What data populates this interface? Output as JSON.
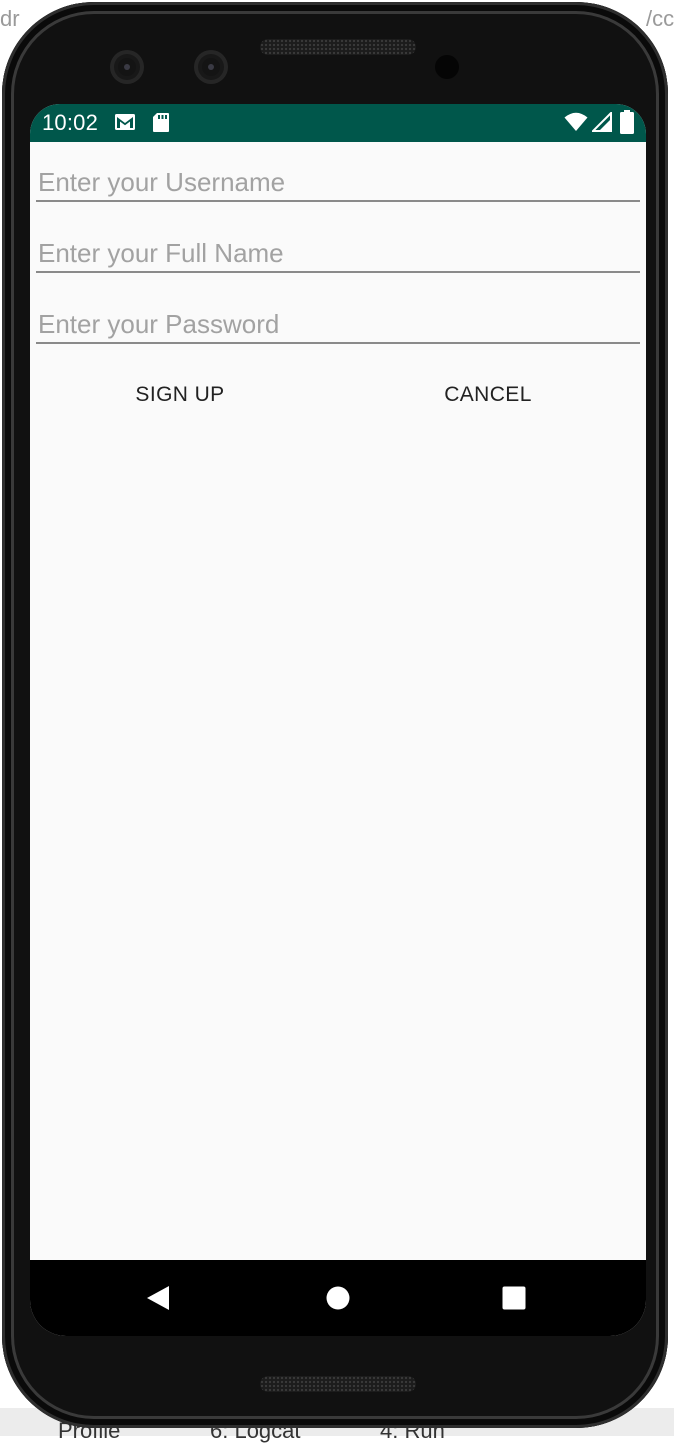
{
  "backdrop": {
    "top_left_fragment": "dr",
    "top_right_fragment": "/cc",
    "bottom_fragments": [
      "Profile",
      "6: Logcat",
      "4: Run"
    ]
  },
  "status_bar": {
    "time": "10:02",
    "color": "#00574b",
    "icons": [
      "gmail-icon",
      "sd-card-icon",
      "wifi-icon",
      "cell-signal-icon",
      "battery-icon"
    ]
  },
  "form": {
    "username_placeholder": "Enter your Username",
    "username_value": "",
    "fullname_placeholder": "Enter your Full Name",
    "fullname_value": "",
    "password_placeholder": "Enter your Password",
    "password_value": ""
  },
  "buttons": {
    "signup_label": "SIGN UP",
    "cancel_label": "CANCEL"
  },
  "nav_bar": {
    "icons": [
      "back-icon",
      "home-icon",
      "recents-icon"
    ]
  }
}
